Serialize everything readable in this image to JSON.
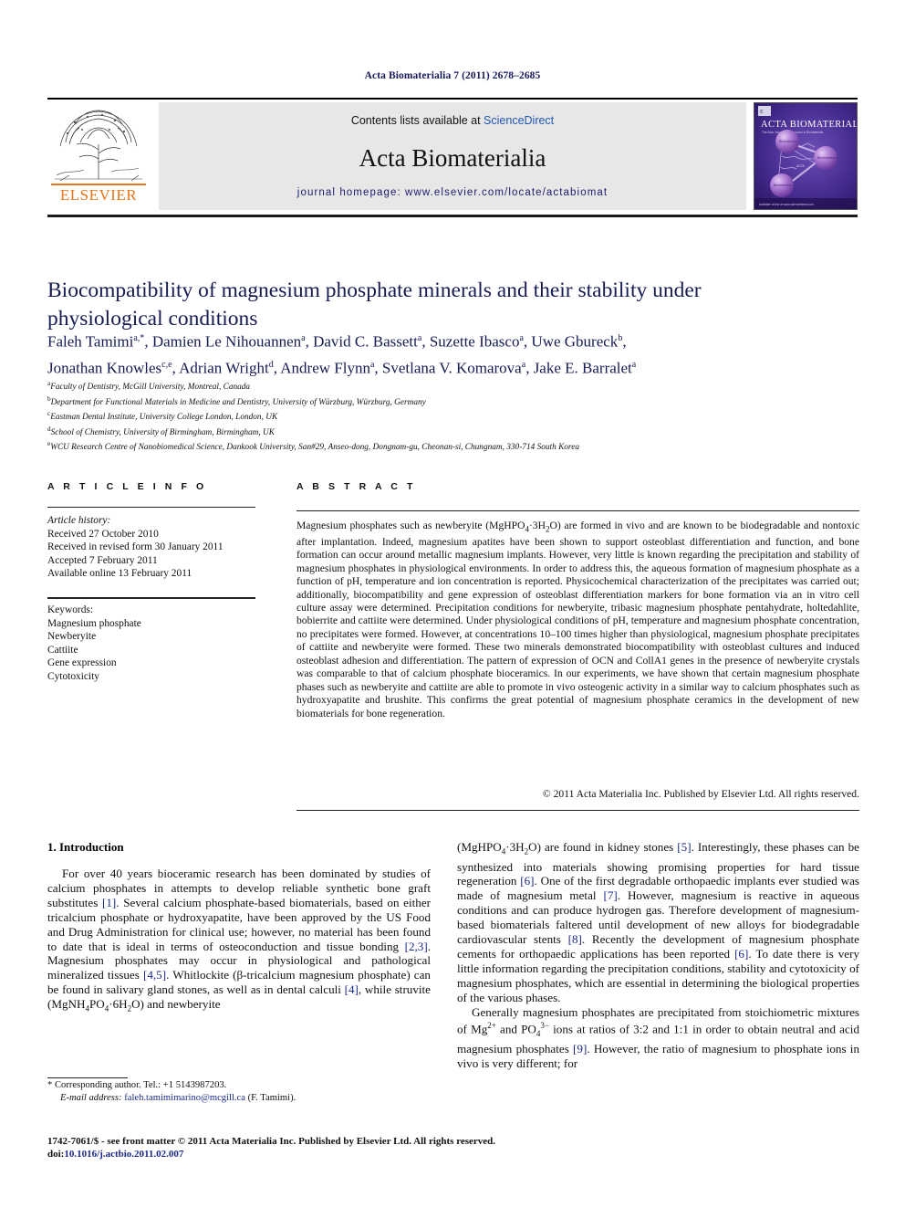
{
  "running_head": "Acta Biomaterialia 7 (2011) 2678–2685",
  "masthead": {
    "contents_prefix": "Contents lists available at ",
    "sciencedirect": "ScienceDirect",
    "journal_title": "Acta Biomaterialia",
    "homepage": "journal homepage: www.elsevier.com/locate/actabiomat",
    "publisher_wordmark": "ELSEVIER",
    "cover_title": "ACTA BIOMATERIALIA",
    "cover_subtitle": "The Acta Journal for Advances in Biomaterials and Biomechanics",
    "accent_link_color": "#2056b5",
    "elsevier_orange": "#e8761b",
    "title_color": "#161b52"
  },
  "article": {
    "title": "Biocompatibility of magnesium phosphate minerals and their stability under physiological conditions",
    "authors_line1": "Faleh Tamimi a,*, Damien Le Nihouannen a, David C. Bassett a, Suzette Ibasco a, Uwe Gbureck b,",
    "authors_line2": "Jonathan Knowles c,e, Adrian Wright d, Andrew Flynn a, Svetlana V. Komarova a, Jake E. Barralet a",
    "affiliations": [
      {
        "marker": "a",
        "text": "Faculty of Dentistry, McGill University, Montreal, Canada"
      },
      {
        "marker": "b",
        "text": "Department for Functional Materials in Medicine and Dentistry, University of Würzburg, Würzburg, Germany"
      },
      {
        "marker": "c",
        "text": "Eastman Dental Institute, University College London, London, UK"
      },
      {
        "marker": "d",
        "text": "School of Chemistry, University of Birmingham, Birmingham, UK"
      },
      {
        "marker": "e",
        "text": "WCU Research Centre of Nanobiomedical Science, Dankook University, San#29, Anseo-dong, Dongnam-gu, Cheonan-si, Chungnam, 330-714 South Korea"
      }
    ]
  },
  "article_info": {
    "heading": "A R T I C L E  I N F O",
    "history_label": "Article history:",
    "history": [
      "Received 27 October 2010",
      "Received in revised form 30 January 2011",
      "Accepted 7 February 2011",
      "Available online 13 February 2011"
    ],
    "keywords_label": "Keywords:",
    "keywords": [
      "Magnesium phosphate",
      "Newberyite",
      "Cattiite",
      "Gene expression",
      "Cytotoxicity"
    ]
  },
  "abstract": {
    "heading": "A B S T R A C T",
    "copyright": "© 2011 Acta Materialia Inc. Published by Elsevier Ltd. All rights reserved.",
    "paragraphs": [
      "Magnesium phosphates such as newberyite (MgHPO4·3H2O) are formed in vivo and are known to be biodegradable and nontoxic after implantation. Indeed, magnesium apatites have been shown to support osteoblast differentiation and function, and bone formation can occur around metallic magnesium implants. However, very little is known regarding the precipitation and stability of magnesium phosphates in physiological environments. In order to address this, the aqueous formation of magnesium phosphate as a function of pH, temperature and ion concentration is reported. Physicochemical characterization of the precipitates was carried out; additionally, biocompatibility and gene expression of osteoblast differentiation markers for bone formation via an in vitro cell culture assay were determined. Precipitation conditions for newberyite, tribasic magnesium phosphate pentahydrate, holtedahlite, bobierrite and cattiite were determined. Under physiological conditions of pH, temperature and magnesium phosphate concentration, no precipitates were formed. However, at concentrations 10–100 times higher than physiological, magnesium phosphate precipitates of cattiite and newberyite were formed. These two minerals demonstrated biocompatibility with osteoblast cultures and induced osteoblast adhesion and differentiation. The pattern of expression of OCN and CollA1 genes in the presence of newberyite crystals was comparable to that of calcium phosphate bioceramics. In our experiments, we have shown that certain magnesium phosphate phases such as newberyite and cattiite are able to promote in vivo osteogenic activity in a similar way to calcium phosphates such as hydroxyapatite and brushite. This confirms the great potential of magnesium phosphate ceramics in the development of new biomaterials for bone regeneration."
    ]
  },
  "body": {
    "section1_heading": "1. Introduction",
    "left_paragraph_1": "For over 40 years bioceramic research has been dominated by studies of calcium phosphates in attempts to develop reliable synthetic bone graft substitutes [1]. Several calcium phosphate-based biomaterials, based on either tricalcium phosphate or hydroxyapatite, have been approved by the US Food and Drug Administration for clinical use; however, no material has been found to date that is ideal in terms of osteoconduction and tissue bonding [2,3]. Magnesium phosphates may occur in physiological and pathological mineralized tissues [4,5]. Whitlockite (β-tricalcium magnesium phosphate) can be found in salivary gland stones, as well as in dental calculi [4], while struvite (MgNH4PO4·6H2O) and newberyite",
    "right_paragraph_1": "(MgHPO4·3H2O) are found in kidney stones [5]. Interestingly, these phases can be synthesized into materials showing promising properties for hard tissue regeneration [6]. One of the first degradable orthopaedic implants ever studied was made of magnesium metal [7]. However, magnesium is reactive in aqueous conditions and can produce hydrogen gas. Therefore development of magnesium-based biomaterials faltered until development of new alloys for biodegradable cardiovascular stents [8]. Recently the development of magnesium phosphate cements for orthopaedic applications has been reported [6]. To date there is very little information regarding the precipitation conditions, stability and cytotoxicity of magnesium phosphates, which are essential in determining the biological properties of the various phases.",
    "right_paragraph_2": "Generally magnesium phosphates are precipitated from stoichiometric mixtures of Mg2+ and PO43− ions at ratios of 3:2 and 1:1 in order to obtain neutral and acid magnesium phosphates [9]. However, the ratio of magnesium to phosphate ions in vivo is very different; for"
  },
  "footnote": {
    "star": "*",
    "corresponding": "Corresponding author. Tel.: +1 5143987203.",
    "email_label": "E-mail address:",
    "email": "faleh.tamimimarino@mcgill.ca",
    "email_owner": "(F. Tamimi)."
  },
  "imprint": {
    "line1": "1742-7061/$ - see front matter © 2011 Acta Materialia Inc. Published by Elsevier Ltd. All rights reserved.",
    "doi_prefix": "doi:",
    "doi": "10.1016/j.actbio.2011.02.007"
  }
}
